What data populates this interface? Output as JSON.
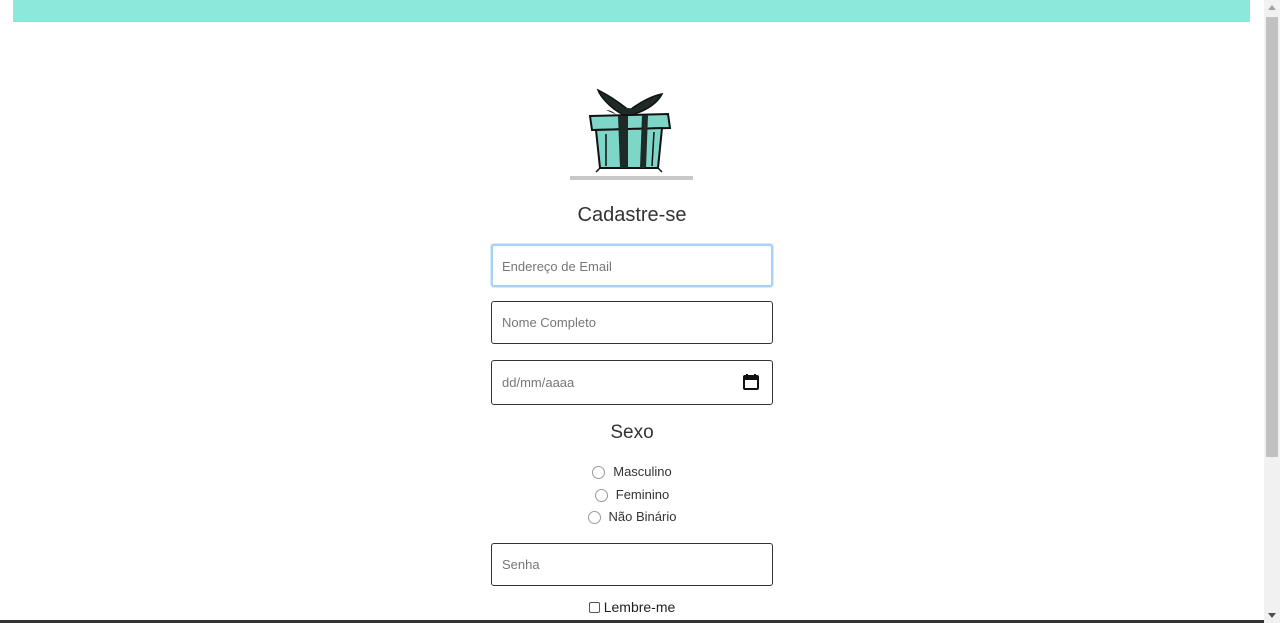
{
  "header": {
    "color": "#8de8dc"
  },
  "logo": {
    "icon": "gift-box-icon",
    "accent_color": "#7ed6c9"
  },
  "form": {
    "title": "Cadastre-se",
    "email": {
      "placeholder": "Endereço de Email",
      "value": ""
    },
    "full_name": {
      "placeholder": "Nome Completo",
      "value": ""
    },
    "birth_date": {
      "placeholder": "dd/mm/aaaa",
      "value": ""
    },
    "gender": {
      "label": "Sexo",
      "options": [
        "Masculino",
        "Feminino",
        "Não Binário"
      ]
    },
    "password": {
      "placeholder": "Senha",
      "value": ""
    },
    "remember_label": "Lembre-me"
  }
}
